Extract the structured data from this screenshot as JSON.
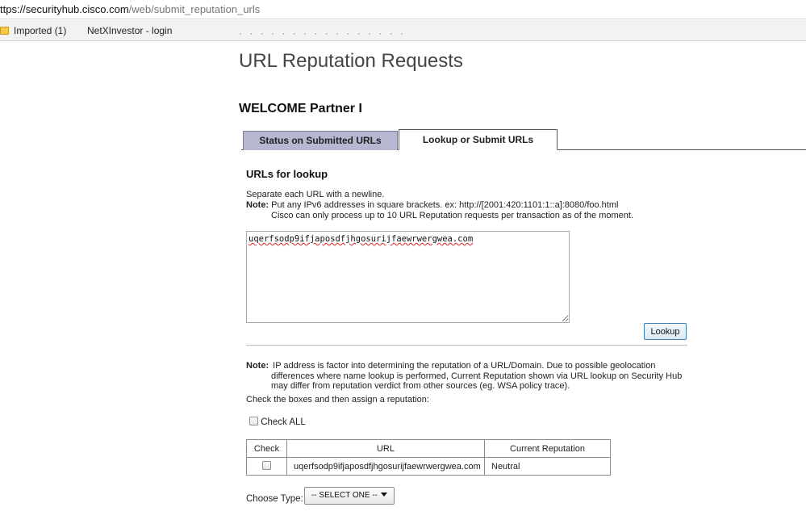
{
  "browser": {
    "url_host": "ttps://securityhub.cisco.com",
    "url_path": "/web/submit_reputation_urls",
    "bookmarks": [
      {
        "label": "Imported (1)",
        "icon": "folder-icon"
      },
      {
        "label": "NetXInvestor - login"
      }
    ]
  },
  "page": {
    "title": "URL Reputation Requests",
    "welcome": "WELCOME Partner I"
  },
  "tabs": [
    {
      "label": "Status on Submitted URLs",
      "active": false
    },
    {
      "label": "Lookup or Submit URLs",
      "active": true
    }
  ],
  "lookup": {
    "heading": "URLs for lookup",
    "instruction": "Separate each URL with a newline.",
    "note_label": "Note:",
    "note_line1": "Put any IPv6 addresses in square brackets. ex: http://[2001:420:1101:1::a]:8080/foo.html",
    "note_line2": "Cisco can only process up to 10 URL Reputation requests per transaction as of the moment.",
    "textarea_value": "uqerfsodp9ifjaposdfjhgosurijfaewrwergwea.com",
    "button_label": "Lookup"
  },
  "results": {
    "note_label": "Note:",
    "note_line1": "IP address is factor into determining the reputation of a URL/Domain. Due to possible geolocation",
    "note_line2": "differences where name lookup is performed, Current Reputation shown via URL lookup on Security Hub",
    "note_line3": "may differ from reputation verdict from other sources (eg. WSA policy trace).",
    "check_instruction": "Check the boxes and then assign a reputation:",
    "check_all_label": "Check ALL",
    "columns": [
      "Check",
      "URL",
      "Current Reputation"
    ],
    "rows": [
      {
        "url": "uqerfsodp9ifjaposdfjhgosurijfaewrwergwea.com",
        "reputation": "Neutral",
        "checked": false
      }
    ],
    "choose_type_label": "Choose Type:",
    "select_value": "-- SELECT ONE --"
  }
}
